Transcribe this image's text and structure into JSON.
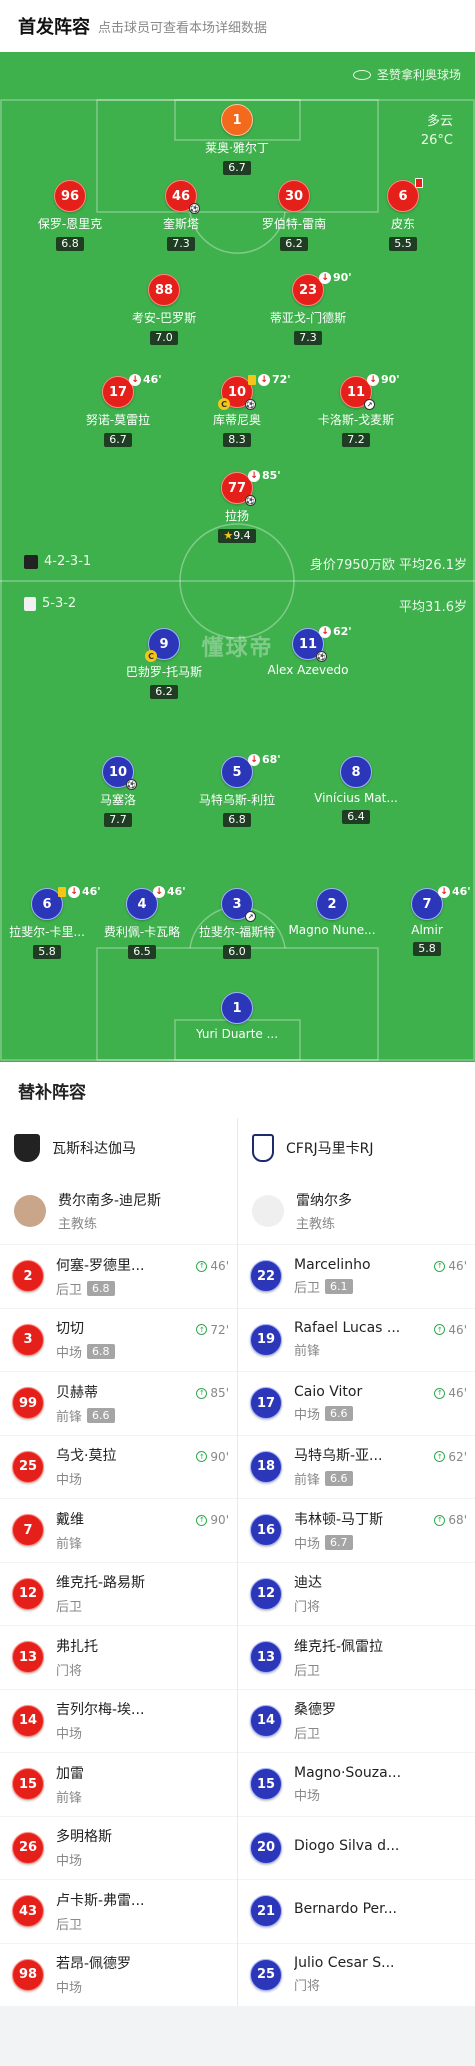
{
  "header": {
    "title": "首发阵容",
    "subtitle": "点击球员可查看本场详细数据"
  },
  "venue": "圣赞拿利奥球场",
  "weather": {
    "cond": "多云",
    "temp": "26°C"
  },
  "home": {
    "formation": "4-2-3-1",
    "value_age": "身价7950万欧 平均26.1岁",
    "players": [
      {
        "num": "1",
        "name": "莱奥·雅尔丁",
        "rating": "6.7"
      },
      {
        "num": "96",
        "name": "保罗-恩里克",
        "rating": "6.8"
      },
      {
        "num": "46",
        "name": "奎斯塔",
        "rating": "7.3"
      },
      {
        "num": "30",
        "name": "罗伯特-雷南",
        "rating": "6.2"
      },
      {
        "num": "6",
        "name": "皮东",
        "rating": "5.5"
      },
      {
        "num": "88",
        "name": "考安-巴罗斯",
        "rating": "7.0"
      },
      {
        "num": "23",
        "name": "蒂亚戈-门德斯",
        "rating": "7.3",
        "sub": "90'"
      },
      {
        "num": "17",
        "name": "努诺-莫雷拉",
        "rating": "6.7",
        "sub": "46'"
      },
      {
        "num": "10",
        "name": "库蒂尼奥",
        "rating": "8.3",
        "sub": "72'"
      },
      {
        "num": "11",
        "name": "卡洛斯-戈麦斯",
        "rating": "7.2",
        "sub": "90'"
      },
      {
        "num": "77",
        "name": "拉扬",
        "rating": "9.4",
        "sub": "85'"
      }
    ]
  },
  "away": {
    "formation": "5-3-2",
    "avg_age": "平均31.6岁",
    "players": [
      {
        "num": "9",
        "name": "巴勃罗-托马斯",
        "rating": "6.2"
      },
      {
        "num": "11",
        "name": "Alex Azevedo",
        "rating": "",
        "sub": "62'"
      },
      {
        "num": "10",
        "name": "马塞洛",
        "rating": "7.7"
      },
      {
        "num": "5",
        "name": "马特乌斯-利拉",
        "rating": "6.8",
        "sub": "68'"
      },
      {
        "num": "8",
        "name": "Vinícius Mat...",
        "rating": "6.4"
      },
      {
        "num": "6",
        "name": "拉斐尔-卡里...",
        "rating": "5.8",
        "sub": "46'"
      },
      {
        "num": "4",
        "name": "费利佩-卡瓦略",
        "rating": "6.5",
        "sub": "46'"
      },
      {
        "num": "3",
        "name": "拉斐尔-福斯特",
        "rating": "6.0"
      },
      {
        "num": "2",
        "name": "Magno Nune...",
        "rating": ""
      },
      {
        "num": "7",
        "name": "Almir",
        "rating": "5.8",
        "sub": "46'"
      },
      {
        "num": "1",
        "name": "Yuri Duarte ...",
        "rating": ""
      }
    ]
  },
  "logo_text": "懂球帝",
  "subs": {
    "title": "替补阵容",
    "home_team": "瓦斯科达伽马",
    "away_team": "CFRJ马里卡RJ",
    "home_coach": {
      "name": "费尔南多-迪尼斯",
      "role": "主教练"
    },
    "away_coach": {
      "name": "雷纳尔多",
      "role": "主教练"
    },
    "home_list": [
      {
        "num": "2",
        "name": "何塞-罗德里...",
        "pos": "后卫",
        "rating": "6.8",
        "min": "46'"
      },
      {
        "num": "3",
        "name": "切切",
        "pos": "中场",
        "rating": "6.8",
        "min": "72'"
      },
      {
        "num": "99",
        "name": "贝赫蒂",
        "pos": "前锋",
        "rating": "6.6",
        "min": "85'"
      },
      {
        "num": "25",
        "name": "乌戈·莫拉",
        "pos": "中场",
        "rating": "",
        "min": "90'"
      },
      {
        "num": "7",
        "name": "戴维",
        "pos": "前锋",
        "rating": "",
        "min": "90'"
      },
      {
        "num": "12",
        "name": "维克托-路易斯",
        "pos": "后卫",
        "rating": "",
        "min": ""
      },
      {
        "num": "13",
        "name": "弗扎托",
        "pos": "门将",
        "rating": "",
        "min": ""
      },
      {
        "num": "14",
        "name": "吉列尔梅-埃...",
        "pos": "中场",
        "rating": "",
        "min": ""
      },
      {
        "num": "15",
        "name": "加雷",
        "pos": "前锋",
        "rating": "",
        "min": ""
      },
      {
        "num": "26",
        "name": "多明格斯",
        "pos": "中场",
        "rating": "",
        "min": ""
      },
      {
        "num": "43",
        "name": "卢卡斯-弗雷...",
        "pos": "后卫",
        "rating": "",
        "min": ""
      },
      {
        "num": "98",
        "name": "若昂-佩德罗",
        "pos": "中场",
        "rating": "",
        "min": ""
      }
    ],
    "away_list": [
      {
        "num": "22",
        "name": "Marcelinho",
        "pos": "后卫",
        "rating": "6.1",
        "min": "46'"
      },
      {
        "num": "19",
        "name": "Rafael Lucas ...",
        "pos": "前锋",
        "rating": "",
        "min": "46'"
      },
      {
        "num": "17",
        "name": "Caio Vitor",
        "pos": "中场",
        "rating": "6.6",
        "min": "46'"
      },
      {
        "num": "18",
        "name": "马特乌斯-亚...",
        "pos": "前锋",
        "rating": "6.6",
        "min": "62'"
      },
      {
        "num": "16",
        "name": "韦林顿-马丁斯",
        "pos": "中场",
        "rating": "6.7",
        "min": "68'"
      },
      {
        "num": "12",
        "name": "迪达",
        "pos": "门将",
        "rating": "",
        "min": ""
      },
      {
        "num": "13",
        "name": "维克托-佩雷拉",
        "pos": "后卫",
        "rating": "",
        "min": ""
      },
      {
        "num": "14",
        "name": "桑德罗",
        "pos": "后卫",
        "rating": "",
        "min": ""
      },
      {
        "num": "15",
        "name": "Magno·Souza...",
        "pos": "中场",
        "rating": "",
        "min": ""
      },
      {
        "num": "20",
        "name": "Diogo Silva d...",
        "pos": "",
        "rating": "",
        "min": ""
      },
      {
        "num": "21",
        "name": "Bernardo Per...",
        "pos": "",
        "rating": "",
        "min": ""
      },
      {
        "num": "25",
        "name": "Julio Cesar S...",
        "pos": "门将",
        "rating": "",
        "min": ""
      }
    ]
  }
}
